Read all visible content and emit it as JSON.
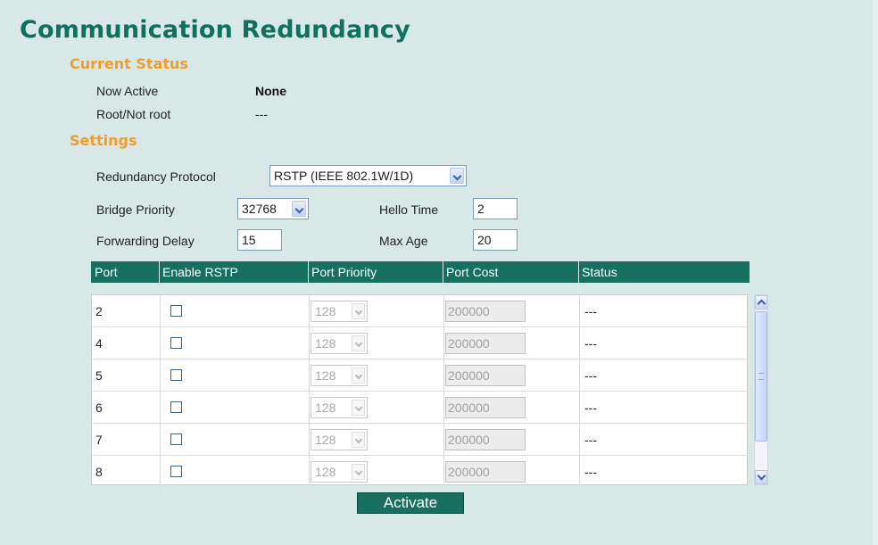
{
  "page": {
    "title": "Communication Redundancy"
  },
  "current_status": {
    "heading": "Current Status",
    "now_active_label": "Now Active",
    "now_active_value": "None",
    "root_label": "Root/Not root",
    "root_value": "---"
  },
  "settings": {
    "heading": "Settings",
    "protocol_label": "Redundancy Protocol",
    "protocol_value": "RSTP (IEEE 802.1W/1D)",
    "bridge_priority_label": "Bridge Priority",
    "bridge_priority_value": "32768",
    "hello_time_label": "Hello Time",
    "hello_time_value": "2",
    "forwarding_delay_label": "Forwarding Delay",
    "forwarding_delay_value": "15",
    "max_age_label": "Max Age",
    "max_age_value": "20"
  },
  "table": {
    "headers": [
      "Port",
      "Enable RSTP",
      "Port Priority",
      "Port Cost",
      "Status"
    ],
    "rows": [
      {
        "port": "2",
        "priority": "128",
        "cost": "200000",
        "status": "---"
      },
      {
        "port": "4",
        "priority": "128",
        "cost": "200000",
        "status": "---"
      },
      {
        "port": "5",
        "priority": "128",
        "cost": "200000",
        "status": "---"
      },
      {
        "port": "6",
        "priority": "128",
        "cost": "200000",
        "status": "---"
      },
      {
        "port": "7",
        "priority": "128",
        "cost": "200000",
        "status": "---"
      },
      {
        "port": "8",
        "priority": "128",
        "cost": "200000",
        "status": "---"
      }
    ]
  },
  "actions": {
    "activate_label": "Activate"
  },
  "colors": {
    "accent": "#17705f",
    "title": "#10705f",
    "section": "#ef9d2c",
    "background": "#d7e8e6"
  }
}
